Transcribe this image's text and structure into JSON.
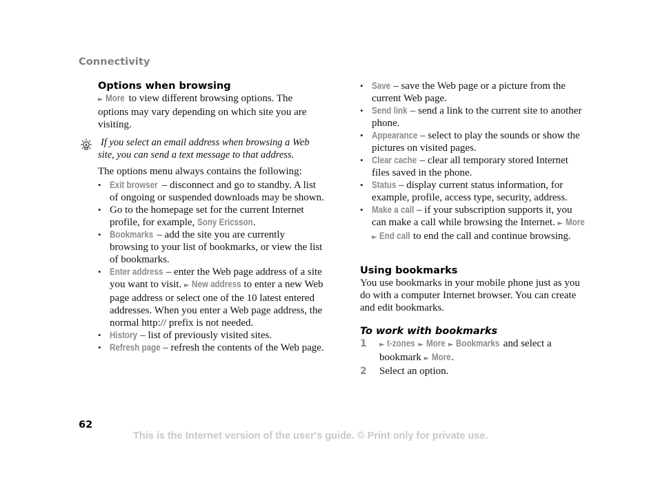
{
  "header": {
    "section": "Connectivity"
  },
  "left": {
    "title": "Options when browsing",
    "intro": {
      "arrow": "►",
      "ui": "More",
      "text": " to view different browsing options. The options may vary depending on which site you are visiting."
    },
    "tip": {
      "icon": "lightbulb-icon",
      "text": "If you select an email address when browsing a Web site, you can send a text message to that address."
    },
    "lead": "The options menu always contains the following:",
    "items": [
      {
        "ui": "Exit browser",
        "text": " – disconnect and go to standby. A list of ongoing or suspended downloads may be shown."
      },
      {
        "pre": "Go to the homepage set for the current Internet profile, for example, ",
        "ui": "Sony Ericsson",
        "text": "."
      },
      {
        "ui": "Bookmarks",
        "text": " – add the site you are currently browsing to your list of bookmarks, or view the list of bookmarks."
      },
      {
        "ui": "Enter address",
        "text": " – enter the Web page address of a site you want to visit. ",
        "arrow": "►",
        "ui2": "New address",
        "text2": " to enter a new Web page address or select one of the 10 latest entered addresses. When you enter a Web page address, the normal http:// prefix is not needed."
      },
      {
        "ui": "History",
        "text": " – list of previously visited sites."
      },
      {
        "ui": "Refresh page",
        "text": " – refresh the contents of the Web page."
      }
    ]
  },
  "right": {
    "items": [
      {
        "ui": "Save",
        "text": " – save the Web page or a picture from the current Web page."
      },
      {
        "ui": "Send link",
        "text": " – send a link to the current site to another phone."
      },
      {
        "ui": "Appearance",
        "text": " – select to play the sounds or show the pictures on visited pages."
      },
      {
        "ui": "Clear cache",
        "text": " – clear all temporary stored Internet files saved in the phone."
      },
      {
        "ui": "Status",
        "text": " – display current status information, for example, profile, access type, security, address."
      },
      {
        "ui": "Make a call",
        "text": " – if your subscription supports it, you can make a call while browsing the Internet. ",
        "arrow": "►",
        "ui2": "More",
        "ui3": "End call",
        "text2": " to end the call and continue browsing."
      }
    ],
    "bookmarks": {
      "title": "Using bookmarks",
      "text": "You use bookmarks in your mobile phone just as you do with a computer Internet browser. You can create and edit bookmarks."
    },
    "procedure": {
      "title": "To work with bookmarks",
      "steps": [
        {
          "num": "1",
          "path": [
            "t-zones",
            "More",
            "Bookmarks"
          ],
          "text": " and select a bookmark ",
          "ui_end": "More",
          "end": "."
        },
        {
          "num": "2",
          "text": "Select an option."
        }
      ]
    }
  },
  "footer": {
    "page_number": "62",
    "notice": "This is the Internet version of the user's guide. © Print only for private use."
  },
  "colors": {
    "ui_text": "#8a8a8a",
    "footer_text": "#c8c8c8",
    "section_title": "#7f7f7f"
  }
}
